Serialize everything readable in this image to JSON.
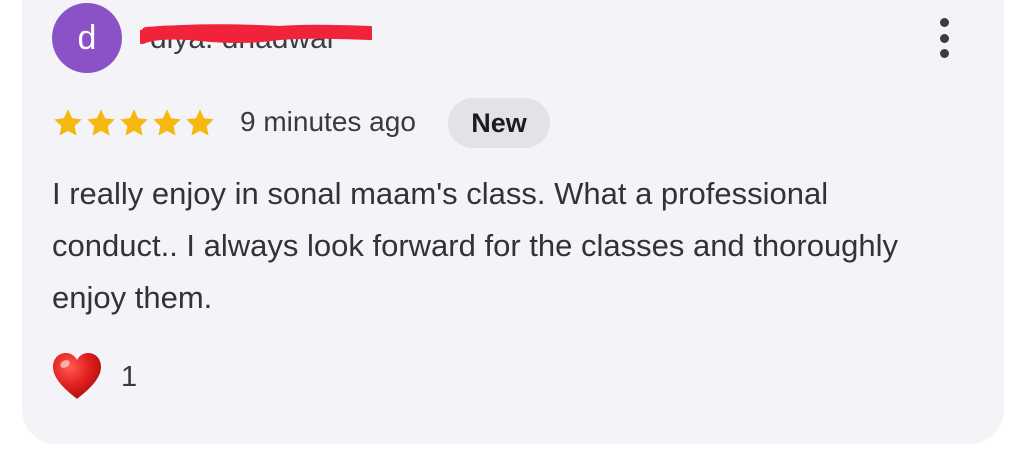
{
  "review": {
    "author_initial": "d",
    "author_name": "diya. dhadwal",
    "time_ago": "9 minutes ago",
    "badge": "New",
    "rating": 5,
    "rating_max": 5,
    "text": "I really enjoy in sonal maam's class. What a professional conduct.. I always look forward for the classes and thoroughly enjoy them.",
    "reaction": {
      "icon": "red-heart-icon",
      "count": "1"
    }
  },
  "icons": {
    "more": "more-vertical-icon",
    "star": "star-icon"
  },
  "colors": {
    "avatar": "#8a52c6",
    "star": "#f6b80f",
    "heart": "#e0201d",
    "redaction": "#f0233a",
    "card": "#f4f3f8",
    "badge": "#e3e2e8"
  }
}
